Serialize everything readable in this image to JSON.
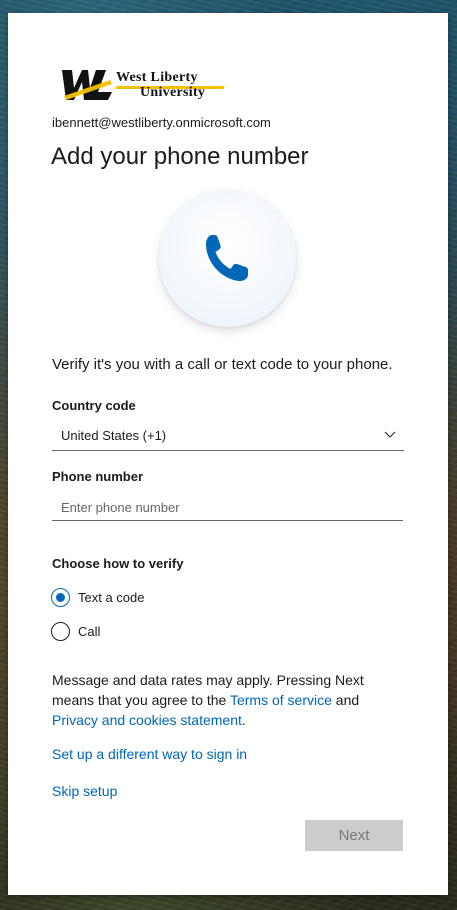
{
  "logo": {
    "line1": "West Liberty",
    "line2": "University",
    "colors": {
      "primary": "#111111",
      "accent": "#f2c200"
    }
  },
  "account": {
    "email": "ibennett@westliberty.onmicrosoft.com"
  },
  "page": {
    "title": "Add your phone number"
  },
  "illustration": {
    "icon": "phone-icon",
    "color": "#0067b8"
  },
  "description": "Verify it's you with a call or text code to your phone.",
  "country": {
    "label": "Country code",
    "selected": "United States (+1)"
  },
  "phone": {
    "label": "Phone number",
    "value": "",
    "placeholder": "Enter phone number"
  },
  "verify": {
    "label": "Choose how to verify",
    "options": [
      {
        "label": "Text a code",
        "checked": true
      },
      {
        "label": "Call",
        "checked": false
      }
    ]
  },
  "notice": {
    "text_before": "Message and data rates may apply. Pressing Next means that you agree to the ",
    "terms_link": "Terms of service",
    "text_middle": " and ",
    "privacy_link": "Privacy and cookies statement",
    "text_after": "."
  },
  "links": {
    "different_way": "Set up a different way to sign in",
    "skip": "Skip setup"
  },
  "buttons": {
    "next": "Next"
  },
  "colors": {
    "link": "#0067b8",
    "button_disabled": "#cccccc"
  }
}
